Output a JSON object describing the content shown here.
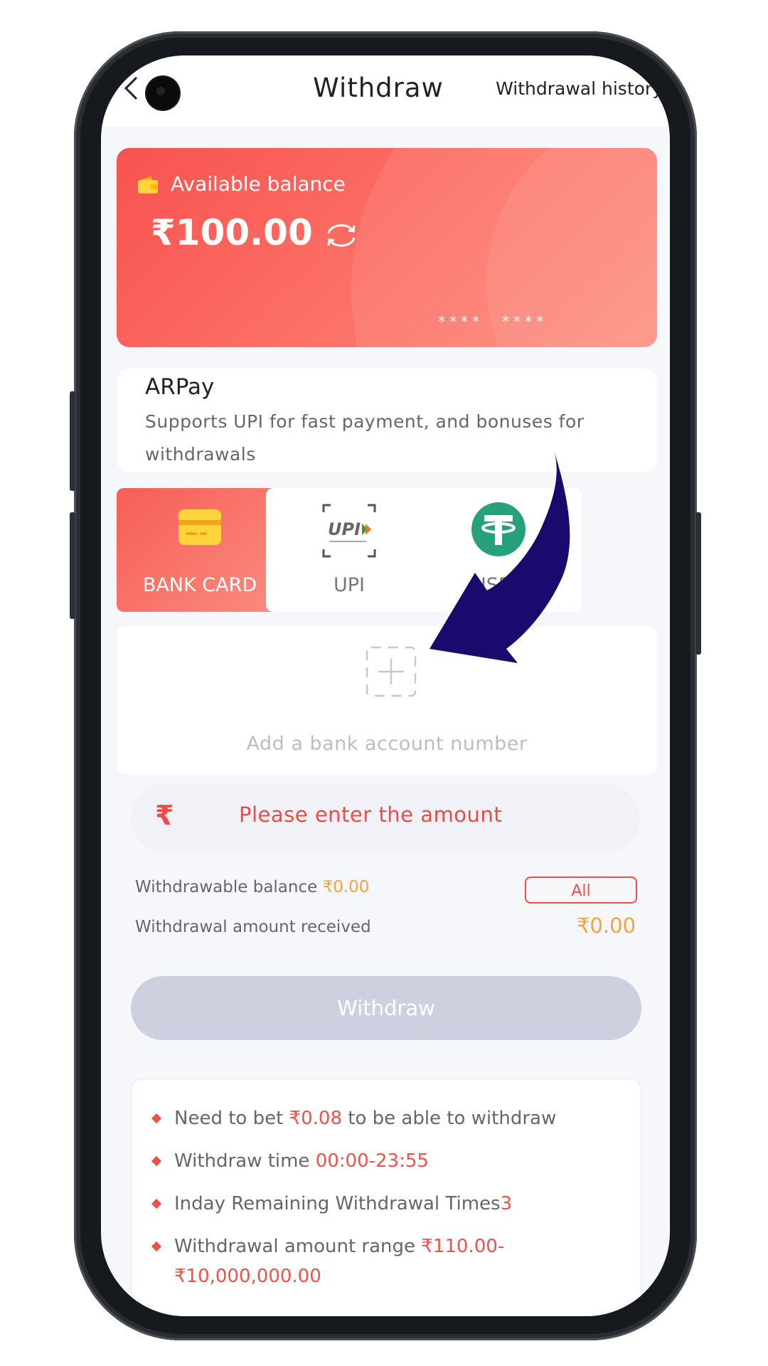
{
  "header": {
    "title": "Withdraw",
    "history_link": "Withdrawal history"
  },
  "balance_card": {
    "label": "Available balance",
    "amount": "₹100.00",
    "masked_left": "****",
    "masked_right": "****"
  },
  "channel": {
    "name": "ARPay",
    "description": "Supports UPI for fast payment, and bonuses for withdrawals"
  },
  "methods": [
    {
      "label": "BANK CARD",
      "active": true,
      "icon": "bank-card-icon"
    },
    {
      "label": "UPI",
      "active": false,
      "icon": "upi-logo-icon"
    },
    {
      "label": "USDT",
      "active": false,
      "icon": "usdt-icon"
    }
  ],
  "add_account": {
    "label": "Add a bank account number"
  },
  "amount_input": {
    "currency_symbol": "₹",
    "placeholder": "Please enter the amount"
  },
  "withdrawable": {
    "label": "Withdrawable balance ",
    "value": "₹0.00",
    "all_button": "All"
  },
  "received": {
    "label": "Withdrawal amount received",
    "value": "₹0.00"
  },
  "withdraw_button": "Withdraw",
  "rules": [
    {
      "prefix": "Need to bet ",
      "highlight": "₹0.08",
      "suffix": " to be able to withdraw"
    },
    {
      "prefix": "Withdraw time ",
      "highlight": "00:00-23:55",
      "suffix": ""
    },
    {
      "prefix": "Inday Remaining Withdrawal Times",
      "highlight": "3",
      "suffix": ""
    },
    {
      "prefix": "Withdrawal amount range ",
      "highlight": "₹110.00-₹10,000,000.00",
      "suffix": ""
    }
  ],
  "colors": {
    "accent_red": "#f0514b",
    "accent_orange": "#f8a23c",
    "button_disabled": "#cdd0de",
    "annotation_arrow": "#1b0a6e"
  }
}
